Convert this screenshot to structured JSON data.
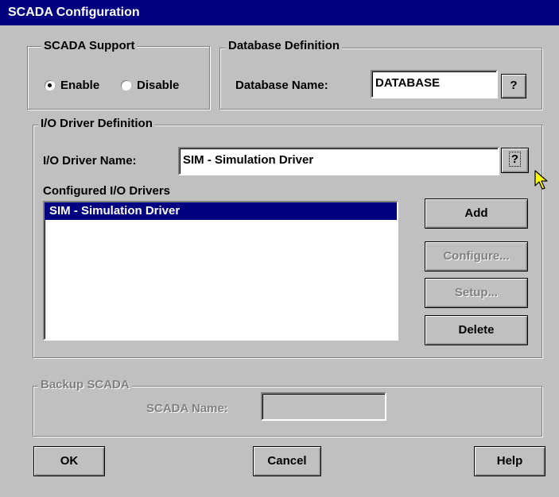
{
  "window": {
    "title": "SCADA Configuration"
  },
  "scada_support": {
    "legend": "SCADA Support",
    "enable_label": "Enable",
    "disable_label": "Disable",
    "selected": "Enable"
  },
  "database": {
    "legend": "Database Definition",
    "name_label": "Database Name:",
    "name_value": "DATABASE",
    "browse_label": "?"
  },
  "io_driver": {
    "legend": "I/O Driver Definition",
    "name_label": "I/O Driver Name:",
    "name_value": "SIM - Simulation Driver",
    "browse_label": "?",
    "configured_label": "Configured I/O Drivers",
    "configured": [
      "SIM - Simulation Driver"
    ],
    "add_label": "Add",
    "configure_label": "Configure...",
    "setup_label": "Setup...",
    "delete_label": "Delete"
  },
  "backup": {
    "legend": "Backup SCADA",
    "name_label": "SCADA Name:",
    "name_value": ""
  },
  "buttons": {
    "ok": "OK",
    "cancel": "Cancel",
    "help": "Help"
  },
  "cursor": {
    "icon": "arrow-pointer-icon",
    "color": "#ffff00"
  },
  "colors": {
    "titlebar": "#000080",
    "face": "#c0c0c0",
    "selection": "#000080",
    "disabled_text": "#808080"
  }
}
